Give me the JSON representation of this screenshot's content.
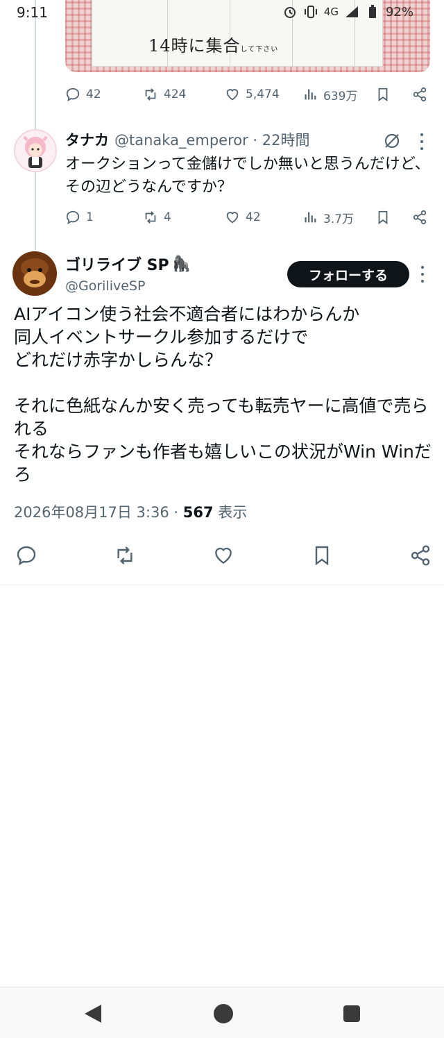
{
  "status_bar": {
    "time": "9:11",
    "network": "4G",
    "battery": "92%",
    "icons": [
      "alarm-icon",
      "vibrate-icon",
      "signal-icon",
      "battery-icon"
    ]
  },
  "thread_image": {
    "text_main": "14時に集合",
    "text_small": "して下さい"
  },
  "first_tweet_actions": {
    "replies": "42",
    "retweets": "424",
    "likes": "5,474",
    "views": "639万"
  },
  "reply_tweet": {
    "name": "タナカ",
    "handle": "@tanaka_emperor · 22時間",
    "text": "オークションって金儲けでしか無いと思うんだけど、その辺どうなんですか？",
    "replies": "1",
    "retweets": "4",
    "likes": "42",
    "views": "3.7万"
  },
  "main_tweet": {
    "name": "ゴリライブ SP",
    "name_emoji": "🦍",
    "handle": "@GoriliveSP",
    "follow_label": "フォローする",
    "text": "AIアイコン使う社会不適合者にはわからんか\n同人イベントサークル参加するだけで\nどれだけ赤字かしらんな？\n\nそれに色紙なんか安く売っても転売ヤーに高値で売られる\nそれならファンも作者も嬉しいこの状況がWin Winだろ",
    "date": "2026年08月17日 3:36 · ",
    "views_count": "567",
    "views_label": " 表示"
  },
  "colors": {
    "text": "#0f1419",
    "muted": "#536471",
    "follow_bg": "#0f1419",
    "divider": "#eff3f4"
  }
}
